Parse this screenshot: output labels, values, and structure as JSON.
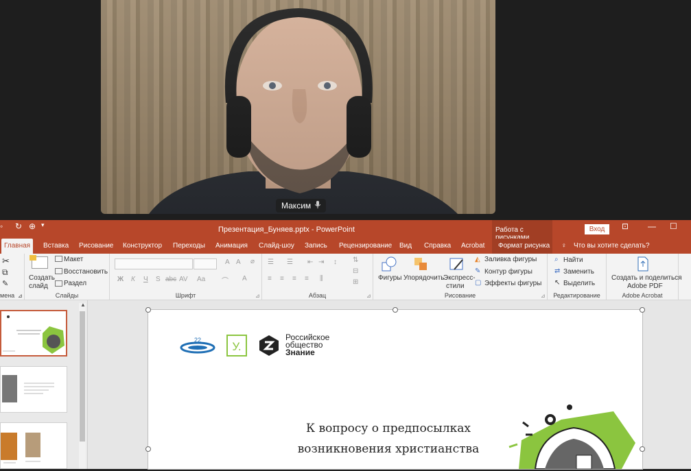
{
  "video": {
    "participant_name": "Максим"
  },
  "titlebar": {
    "title": "Презентация_Буняев.pptx  -  PowerPoint",
    "context_group": "Работа с рисунками",
    "signin": "Вход"
  },
  "tabs": [
    "Главная",
    "Вставка",
    "Рисование",
    "Конструктор",
    "Переходы",
    "Анимация",
    "Слайд-шоу",
    "Запись",
    "Рецензирование",
    "Вид",
    "Справка",
    "Acrobat",
    "Формат рисунка"
  ],
  "tell_me": "Что вы хотите сделать?",
  "ribbon": {
    "clipboard_label": "мена",
    "slides": {
      "new_slide_1": "Создать",
      "new_slide_2": "слайд",
      "layout": "Макет",
      "reset": "Восстановить",
      "section": "Раздел",
      "label": "Слайды"
    },
    "font": {
      "label": "Шрифт",
      "bold": "Ж",
      "italic": "К",
      "underline": "Ч",
      "shadow": "S",
      "strike": "abc",
      "case": "Aa"
    },
    "paragraph": {
      "label": "Абзац"
    },
    "drawing": {
      "shapes": "Фигуры",
      "arrange": "Упорядочить",
      "quick_styles_1": "Экспресс-",
      "quick_styles_2": "стили",
      "fill": "Заливка фигуры",
      "outline": "Контур фигуры",
      "effects": "Эффекты фигуры",
      "label": "Рисование"
    },
    "editing": {
      "find": "Найти",
      "replace": "Заменить",
      "select": "Выделить",
      "label": "Редактирование"
    },
    "acrobat": {
      "create_1": "Создать и поделиться",
      "create_2": "Adobe PDF",
      "label": "Adobe Acrobat"
    }
  },
  "slide": {
    "logo_text_1": "Российское",
    "logo_text_2": "общество",
    "logo_text_3": "Знание",
    "title_line_1": "К вопросу о предпосылках",
    "title_line_2": "возникновения христианства"
  },
  "colors": {
    "accent": "#b7472a",
    "context": "#a13e24",
    "green": "#8bc53f"
  }
}
